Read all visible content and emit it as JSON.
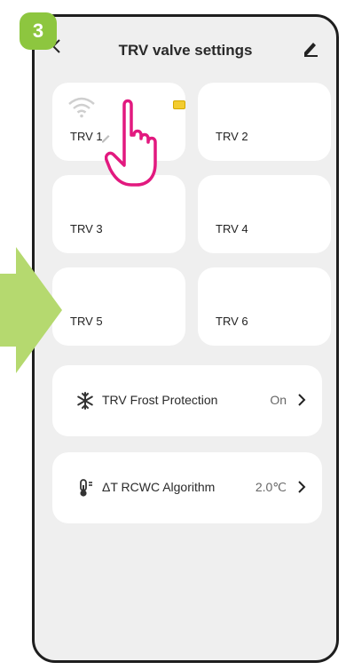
{
  "step": {
    "number": "3",
    "color": "#8dc63f"
  },
  "header": {
    "title": "TRV valve settings"
  },
  "tiles": [
    {
      "label": "TRV 1"
    },
    {
      "label": "TRV 2"
    },
    {
      "label": "TRV 3"
    },
    {
      "label": "TRV 4"
    },
    {
      "label": "TRV 5"
    },
    {
      "label": "TRV 6"
    }
  ],
  "settings": [
    {
      "icon": "snowflake-icon",
      "label": "TRV Frost Protection",
      "value": "On"
    },
    {
      "icon": "thermometer-icon",
      "label": "ΔT RCWC Algorithm",
      "value": "2.0℃"
    }
  ],
  "colors": {
    "accent": "#8dc63f",
    "pointer": "#e2197f",
    "battery": "#f3cc30"
  }
}
